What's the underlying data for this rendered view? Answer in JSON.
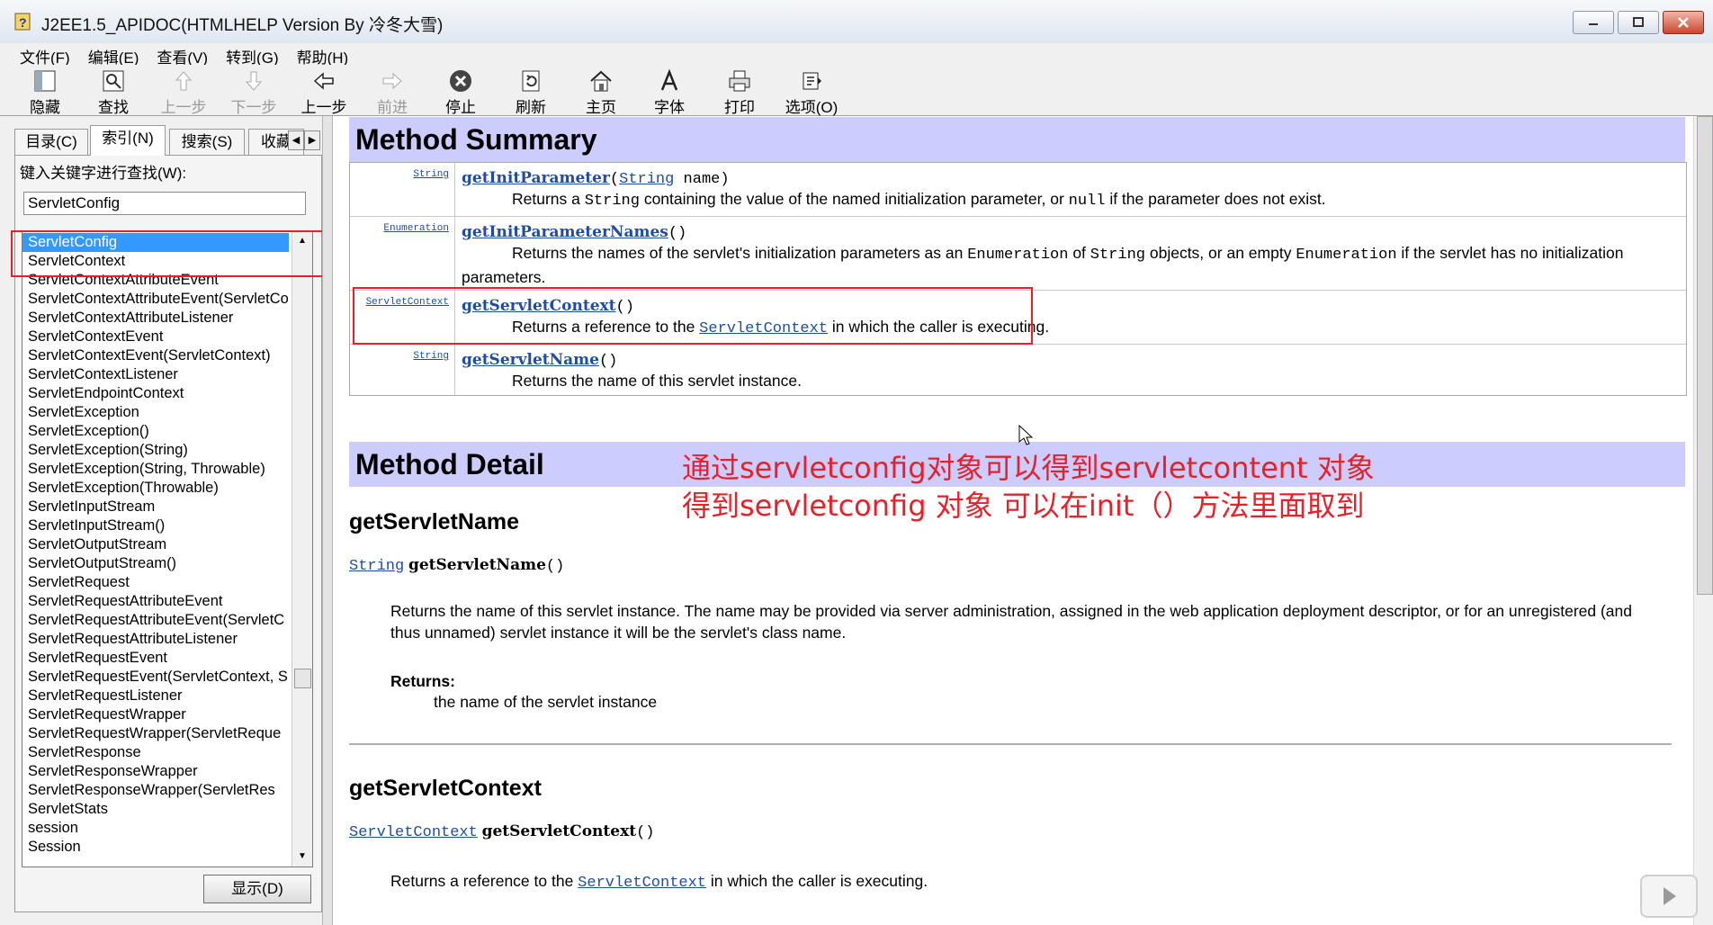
{
  "window": {
    "title": "J2EE1.5_APIDOC(HTMLHELP Version By 冷冬大雪)"
  },
  "menu": [
    "文件(F)",
    "编辑(E)",
    "查看(V)",
    "转到(G)",
    "帮助(H)"
  ],
  "toolbar": {
    "hide": "隐藏",
    "find": "查找",
    "prev": "上一步",
    "next": "下一步",
    "back": "上一步",
    "forward": "前进",
    "stop": "停止",
    "refresh": "刷新",
    "home": "主页",
    "font": "字体",
    "print": "打印",
    "options": "选项(O)"
  },
  "tabs": {
    "contents": "目录(C)",
    "index": "索引(N)",
    "search": "搜索(S)",
    "favorites": "收藏"
  },
  "index_pane": {
    "keyword_label": "键入关键字进行查找(W):",
    "keyword_value": "ServletConfig",
    "items": [
      "ServletConfig",
      "ServletContext",
      "ServletContextAttributeEvent",
      "ServletContextAttributeEvent(ServletCo",
      "ServletContextAttributeListener",
      "ServletContextEvent",
      "ServletContextEvent(ServletContext)",
      "ServletContextListener",
      "ServletEndpointContext",
      "ServletException",
      "ServletException()",
      "ServletException(String)",
      "ServletException(String, Throwable)",
      "ServletException(Throwable)",
      "ServletInputStream",
      "ServletInputStream()",
      "ServletOutputStream",
      "ServletOutputStream()",
      "ServletRequest",
      "ServletRequestAttributeEvent",
      "ServletRequestAttributeEvent(ServletC",
      "ServletRequestAttributeListener",
      "ServletRequestEvent",
      "ServletRequestEvent(ServletContext, S",
      "ServletRequestListener",
      "ServletRequestWrapper",
      "ServletRequestWrapper(ServletReque",
      "ServletResponse",
      "ServletResponseWrapper",
      "ServletResponseWrapper(ServletRes",
      "ServletStats",
      "session",
      "Session"
    ],
    "display_button": "显示(D)"
  },
  "summary": {
    "heading": "Method Summary",
    "rows": [
      {
        "type": "String",
        "name": "getInitParameter",
        "params_type": "String",
        "params_rest": " name)",
        "desc_pre": "Returns a ",
        "desc_code1": "String",
        "desc_mid": " containing the value of the named initialization parameter, or ",
        "desc_code2": "null",
        "desc_post": " if the parameter does not exist."
      },
      {
        "type": "Enumeration",
        "name": "getInitParameterNames",
        "params": "()",
        "desc_pre": "Returns the names of the servlet's initialization parameters as an ",
        "desc_code1": "Enumeration",
        "desc_mid": " of ",
        "desc_code2": "String",
        "desc_mid2": " objects, or an empty ",
        "desc_code3": "Enumeration",
        "desc_post": " if the servlet has no initialization parameters."
      },
      {
        "type": "ServletContext",
        "name": "getServletContext",
        "params": "()",
        "desc_pre": "Returns a reference to the ",
        "desc_link": "ServletContext",
        "desc_post": " in which the caller is executing."
      },
      {
        "type": "String",
        "name": "getServletName",
        "params": "()",
        "desc": "Returns the name of this servlet instance."
      }
    ]
  },
  "detail": {
    "heading": "Method Detail",
    "annotation_line1": "通过servletconfig对象可以得到servletcontent 对象",
    "annotation_line2": "得到servletconfig 对象 可以在init（）方法里面取到",
    "m1": {
      "title": "getServletName",
      "type": "String",
      "name": "getServletName",
      "params": "()",
      "desc": "Returns the name of this servlet instance. The name may be provided via server administration, assigned in the web application deployment descriptor, or for an unregistered (and thus unnamed) servlet instance it will be the servlet's class name.",
      "returns_label": "Returns:",
      "returns_text": "the name of the servlet instance"
    },
    "m2": {
      "title": "getServletContext",
      "type": "ServletContext",
      "name": "getServletContext",
      "params": "()",
      "desc_pre": "Returns a reference to the ",
      "desc_link": "ServletContext",
      "desc_post": " in which the caller is executing."
    }
  },
  "colors": {
    "accent_red": "#e8202a",
    "header_bg": "#ccccff",
    "link": "#1f4ea0",
    "selection": "#3399ff"
  }
}
